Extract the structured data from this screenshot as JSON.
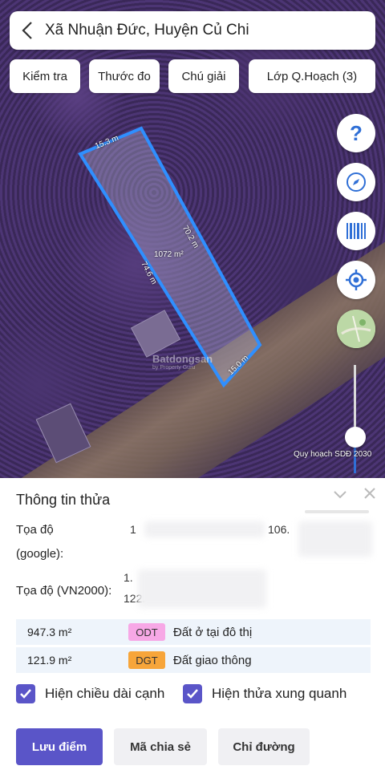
{
  "header": {
    "title": "Xã Nhuận Đức, Huyện Củ Chi"
  },
  "toolbar": {
    "buttons": [
      {
        "label": "Kiểm tra"
      },
      {
        "label": "Thước đo"
      },
      {
        "label": "Chú giải"
      },
      {
        "label": "Lớp Q.Hoạch (3)"
      }
    ]
  },
  "map": {
    "plot": {
      "area_label": "1072 m²",
      "edge_top": "15.3 m",
      "edge_right": "70.2 m",
      "edge_bottom": "15.0 m",
      "edge_left": "74.6 m"
    },
    "watermark": {
      "brand": "Batdongsan",
      "sub": "by Property Guru"
    },
    "controls": {
      "help": "help-icon",
      "compass": "compass-icon",
      "barcode": "barcode-icon",
      "locate": "locate-icon",
      "layers": "map-layer-icon"
    },
    "slider_caption": "Quy hoạch SDĐ 2030",
    "slider_level": 0.38
  },
  "sheet": {
    "title": "Thông tin thửa",
    "coord_google_label_1": "Tọa độ",
    "coord_google_label_2": "(google):",
    "coord_google_value_1": "1",
    "coord_google_value_2": "106.",
    "coord_vn2000_label": "Tọa độ (VN2000):",
    "coord_vn2000_value_1": "1.",
    "coord_vn2000_value_2": "122.",
    "land_rows": [
      {
        "area": "947.3 m²",
        "code": "ODT",
        "desc": "Đất ở tại đô thị",
        "color": "#f7a8e6"
      },
      {
        "area": "121.9 m²",
        "code": "DGT",
        "desc": "Đất giao thông",
        "color": "#f7a53a"
      }
    ],
    "checkbox_edges": "Hiện chiều dài cạnh",
    "checkbox_neighbors": "Hiện thửa xung quanh",
    "buttons": {
      "save": "Lưu điểm",
      "share": "Mã chia sẻ",
      "directions": "Chỉ đường"
    }
  },
  "colors": {
    "accent": "#5a55c8",
    "plot_border": "#2f8fff"
  }
}
